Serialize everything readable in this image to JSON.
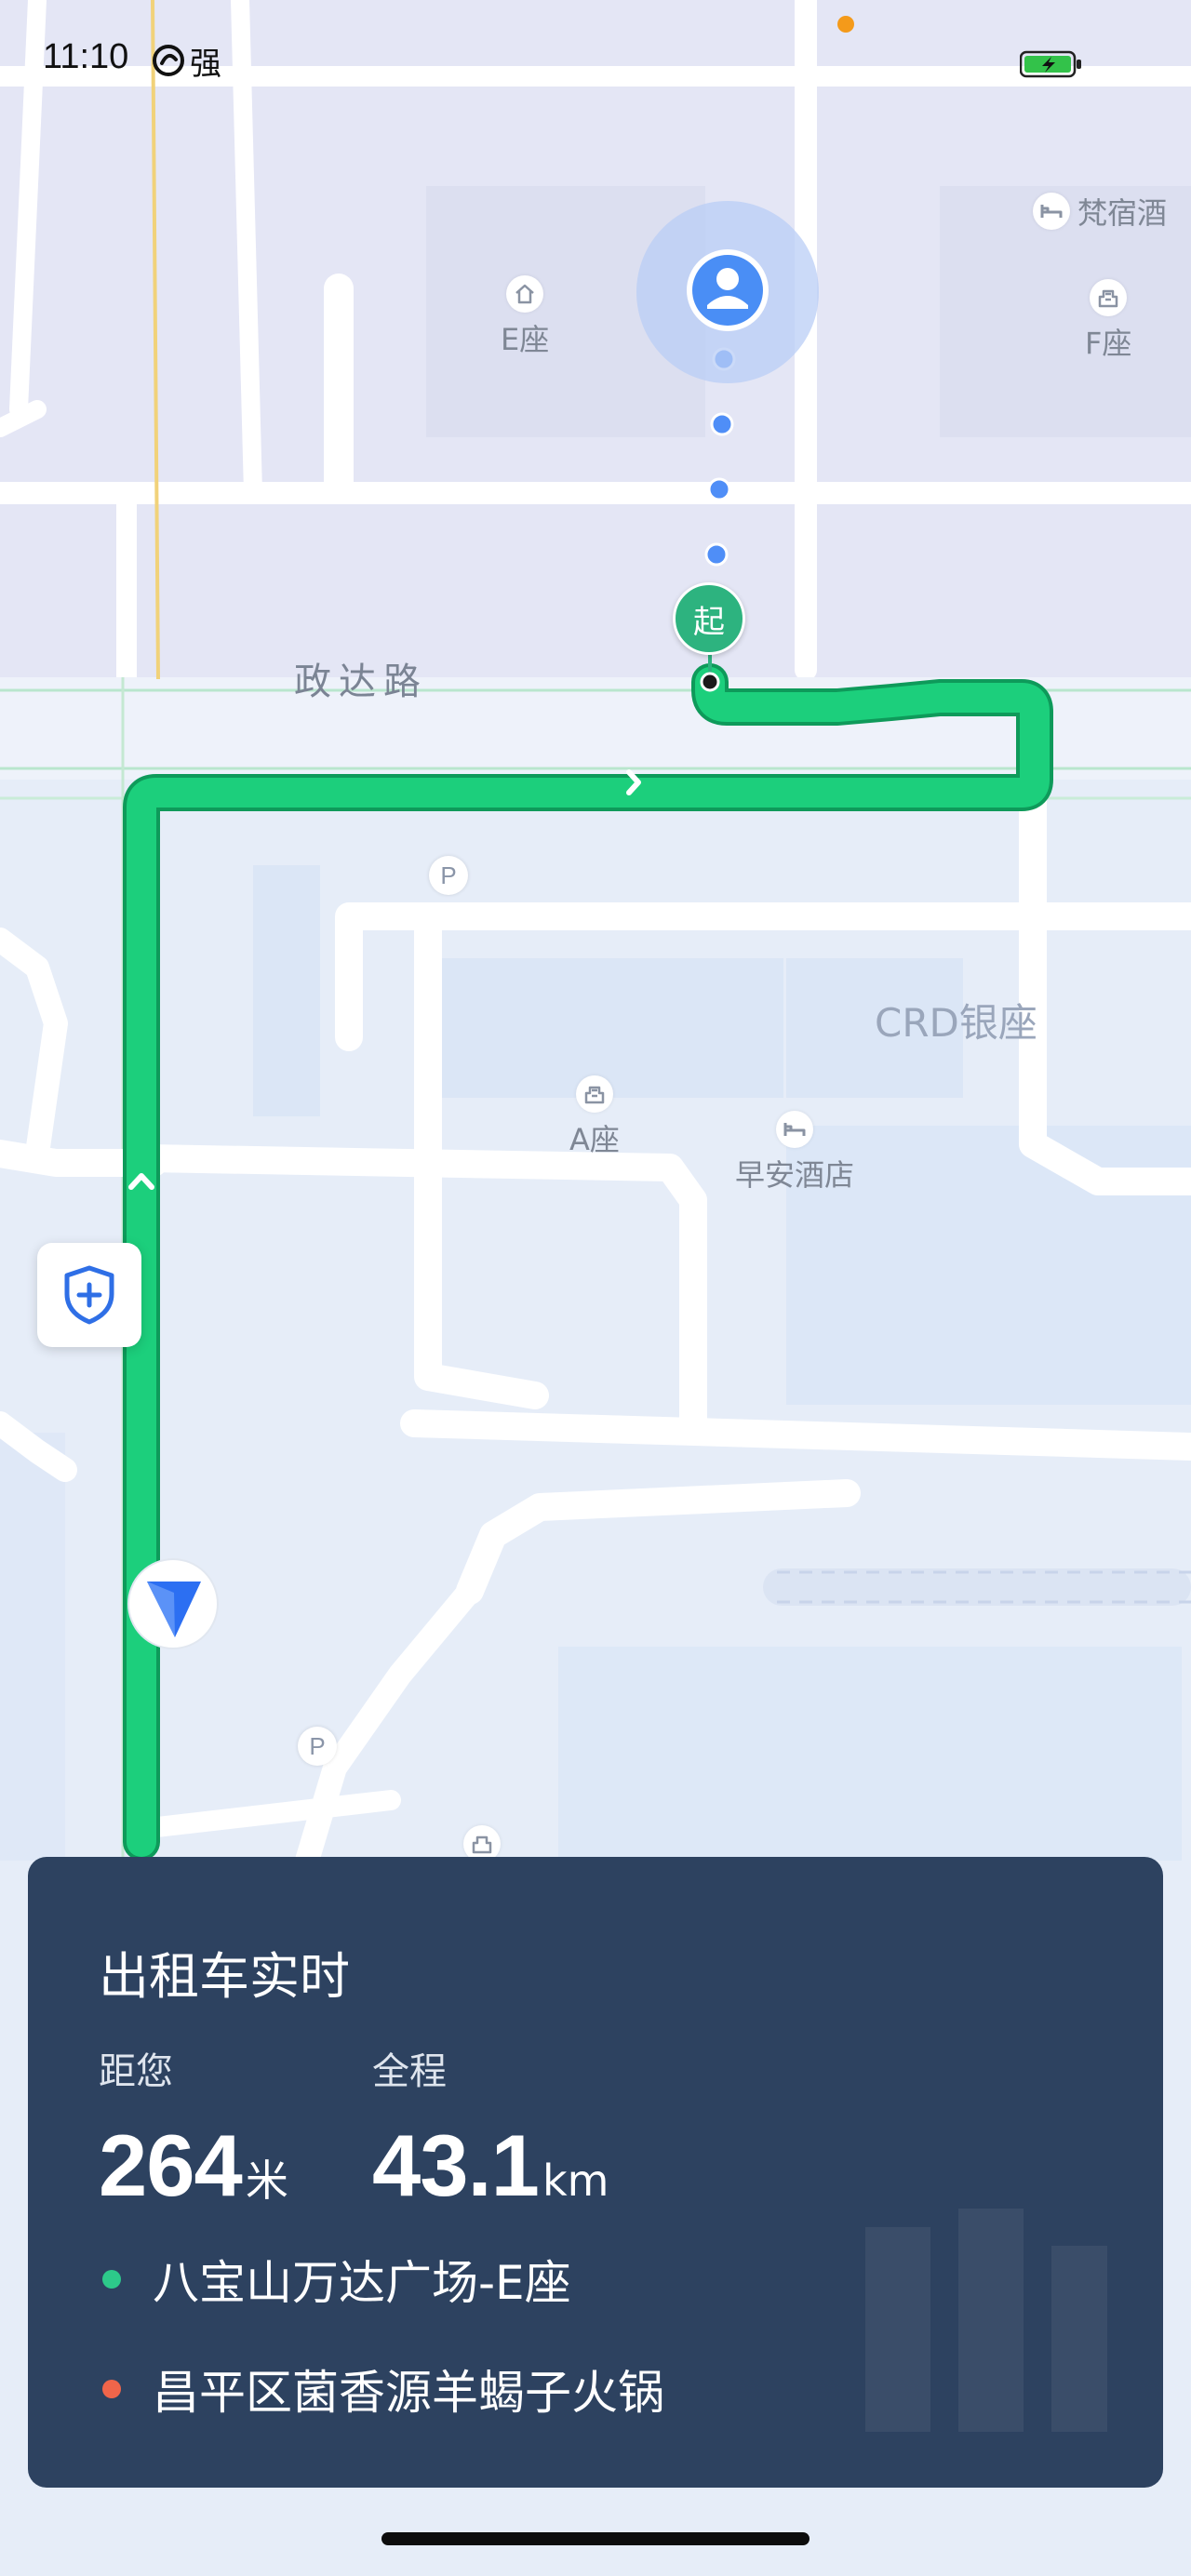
{
  "status_bar": {
    "time": "11:10",
    "carrier": "强",
    "battery_state": "charging",
    "battery_color": "#33c24a"
  },
  "map": {
    "road_label": "政达路",
    "district_label": "CRD银座",
    "pois": [
      {
        "name": "E座",
        "icon": "building-home-icon"
      },
      {
        "name": "F座",
        "icon": "office-building-icon"
      },
      {
        "name": "梵宿酒",
        "icon": "hotel-bed-icon"
      },
      {
        "name": "A座",
        "icon": "office-building-icon"
      },
      {
        "name": "早安酒店",
        "icon": "hotel-bed-icon"
      }
    ],
    "parking_label": "P",
    "start_pin_label": "起",
    "route_color": "#14c271",
    "walking_dots_color": "#4f8ef7",
    "user_marker_color": "#4a8ef5",
    "taxi_marker_color": "#2c6ff2"
  },
  "taxi_card": {
    "title": "出租车实时",
    "distance_label": "距您",
    "distance_value": "264",
    "distance_unit": "米",
    "total_label": "全程",
    "total_value": "43.1",
    "total_unit": "km",
    "origin": "八宝山万达广场-E座",
    "destination": "昌平区菌香源羊蝎子火锅",
    "origin_dot_color": "#2dc98a",
    "destination_dot_color": "#f0654a"
  }
}
